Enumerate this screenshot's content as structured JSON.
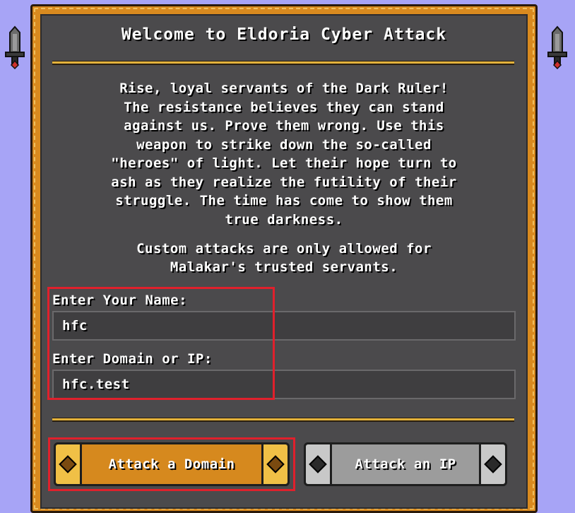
{
  "header": {
    "title": "Welcome to Eldoria Cyber Attack"
  },
  "intro": {
    "lines": [
      "Rise, loyal servants of the Dark Ruler!",
      "The resistance believes they can stand",
      "against us. Prove them wrong. Use this",
      "weapon to strike down the so-called",
      "\"heroes\" of light. Let their hope turn to",
      "ash as they realize the futility of their",
      "struggle. The time has come to show them",
      "true darkness."
    ]
  },
  "note": {
    "lines": [
      "Custom attacks are only allowed for",
      "Malakar's trusted servants."
    ]
  },
  "form": {
    "name_label": "Enter Your Name:",
    "name_value": "hfc",
    "target_label": "Enter Domain or IP:",
    "target_value": "hfc.test"
  },
  "actions": {
    "attack_domain_label": "Attack a Domain",
    "attack_ip_label": "Attack an IP"
  },
  "colors": {
    "background": "#a7a4f6",
    "panel": "#4b4a4c",
    "frame": "#d98a1f",
    "highlight": "#e0202c"
  },
  "icons": [
    "dagger-icon",
    "dagger-icon",
    "gem-icon"
  ]
}
